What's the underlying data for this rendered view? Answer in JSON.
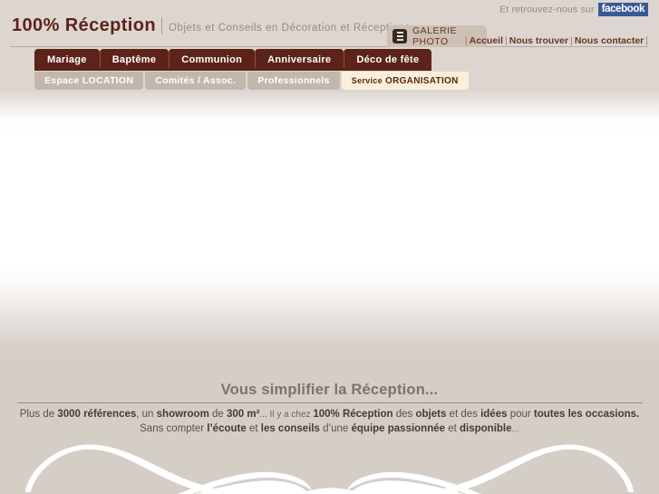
{
  "site": {
    "logo_main": "100% Réception",
    "logo_sub": "Objets et Conseils en Décoration et Réceptions"
  },
  "header": {
    "social_text": "Et retrouvez-nous sur",
    "facebook_label": "facebook",
    "galerie_label": "GALERIE PHOTO",
    "galerie_icon": "film-strip-icon",
    "links": [
      {
        "label": "Accueil"
      },
      {
        "label": "Nous trouver"
      },
      {
        "label": "Nous contacter"
      }
    ],
    "link_separator": "|"
  },
  "nav_main": [
    {
      "label": "Mariage"
    },
    {
      "label": "Baptême"
    },
    {
      "label": "Communion"
    },
    {
      "label": "Anniversaire"
    },
    {
      "label": "Déco de fête"
    }
  ],
  "nav_sub": [
    {
      "label": "Espace LOCATION",
      "active": false
    },
    {
      "label": "Comités / Assoc.",
      "active": false
    },
    {
      "label": "Professionnels",
      "active": false
    },
    {
      "label": "Service ORGANISATION",
      "active": true,
      "prefix": "Service",
      "suffix": "ORGANISATION"
    }
  ],
  "tagline": {
    "heading": "Vous simplifier la Réception...",
    "line1": {
      "t1": "Plus de ",
      "b1": "3000 références",
      "t2": ", un ",
      "b2": "showroom",
      "t3": " de ",
      "b3": "300 m²",
      "t4": "... Il y a chez ",
      "b4": "100% Réception",
      "t5": " des ",
      "b5": "objets",
      "t6": " et des ",
      "b6": "idées",
      "t7": " pour ",
      "b7": "toutes les occasions."
    },
    "line2": {
      "t1": "Sans compter ",
      "b1": "l’écoute",
      "t2": " et ",
      "b2": "les conseils",
      "t3": " d’une ",
      "b3": "équipe passionnée",
      "t4": " et ",
      "b4": "disponible",
      "t5": "..."
    }
  },
  "colors": {
    "brand_dark": "#5c2318",
    "brand_mid": "#6d3326",
    "nav_sub": "#c3b6ab",
    "active_tab": "#faefd9",
    "facebook": "#3b5998",
    "page_bg": "#d5cec7"
  }
}
